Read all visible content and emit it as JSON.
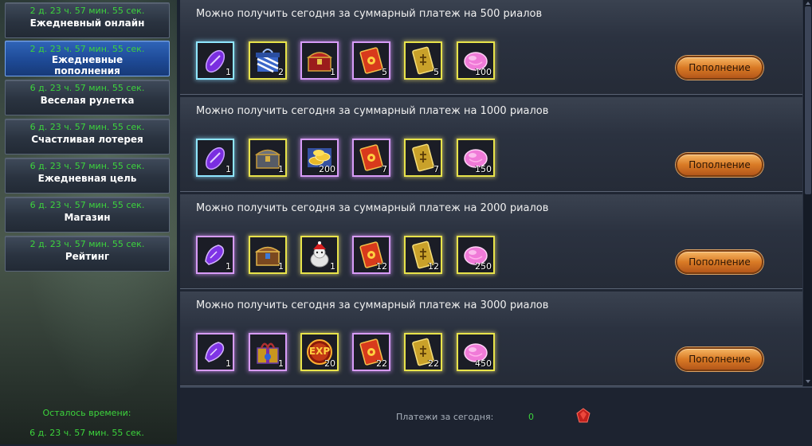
{
  "sidebar": {
    "items": [
      {
        "timer": "2 д. 23 ч. 57 мин. 55 сек.",
        "label": "Ежедневный онлайн"
      },
      {
        "timer": "2 д. 23 ч. 57 мин. 55 сек.",
        "label": "Ежедневные пополнения"
      },
      {
        "timer": "6 д. 23 ч. 57 мин. 55 сек.",
        "label": "Веселая рулетка"
      },
      {
        "timer": "6 д. 23 ч. 57 мин. 55 сек.",
        "label": "Счастливая лотерея"
      },
      {
        "timer": "6 д. 23 ч. 57 мин. 55 сек.",
        "label": "Ежедневная цель"
      },
      {
        "timer": "6 д. 23 ч. 57 мин. 55 сек.",
        "label": "Магазин"
      },
      {
        "timer": "2 д. 23 ч. 57 мин. 55 сек.",
        "label": "Рейтинг"
      }
    ],
    "active_index": 1,
    "remaining_label": "Осталось времени:",
    "remaining_value": "6 д. 23 ч. 57 мин. 55 сек."
  },
  "rewards": [
    {
      "title": "Можно получить сегодня за суммарный платеж на 500 риалов",
      "button": "Пополнение",
      "items": [
        {
          "icon": "purple-crystal-icon",
          "frame": "cyan",
          "count": "1"
        },
        {
          "icon": "blue-striped-gift-box-icon",
          "frame": "yellow",
          "count": "2"
        },
        {
          "icon": "red-treasure-chest-icon",
          "frame": "purple",
          "count": "1"
        },
        {
          "icon": "red-talisman-card-icon",
          "frame": "purple",
          "count": "5"
        },
        {
          "icon": "gold-ticket-icon",
          "frame": "yellow",
          "count": "5"
        },
        {
          "icon": "pink-jade-stone-icon",
          "frame": "yellow",
          "count": "100"
        }
      ]
    },
    {
      "title": "Можно получить сегодня за суммарный платеж на 1000 риалов",
      "button": "Пополнение",
      "items": [
        {
          "icon": "purple-crystal-icon",
          "frame": "cyan",
          "count": "1"
        },
        {
          "icon": "iron-treasure-chest-icon",
          "frame": "yellow",
          "count": "1"
        },
        {
          "icon": "gold-coin-pile-icon",
          "frame": "purple",
          "count": "200"
        },
        {
          "icon": "red-talisman-card-icon",
          "frame": "purple",
          "count": "7"
        },
        {
          "icon": "gold-ticket-icon",
          "frame": "yellow",
          "count": "7"
        },
        {
          "icon": "pink-jade-stone-icon",
          "frame": "yellow",
          "count": "150"
        }
      ]
    },
    {
      "title": "Можно получить сегодня за суммарный платеж на 2000 риалов",
      "button": "Пополнение",
      "items": [
        {
          "icon": "purple-shoe-icon",
          "frame": "purple",
          "count": "1"
        },
        {
          "icon": "wooden-treasure-chest-icon",
          "frame": "yellow",
          "count": "1"
        },
        {
          "icon": "santa-pet-icon",
          "frame": "yellow",
          "count": "1"
        },
        {
          "icon": "red-talisman-card-icon",
          "frame": "purple",
          "count": "12"
        },
        {
          "icon": "gold-ticket-icon",
          "frame": "yellow",
          "count": "12"
        },
        {
          "icon": "pink-jade-stone-icon",
          "frame": "yellow",
          "count": "250"
        }
      ]
    },
    {
      "title": "Можно получить сегодня за суммарный платеж на 3000 риалов",
      "button": "Пополнение",
      "items": [
        {
          "icon": "purple-shoe-icon",
          "frame": "purple",
          "count": "1"
        },
        {
          "icon": "gold-gift-box-icon",
          "frame": "purple",
          "count": "1"
        },
        {
          "icon": "exp-orb-icon",
          "frame": "yellow",
          "count": "20"
        },
        {
          "icon": "red-talisman-card-icon",
          "frame": "purple",
          "count": "22"
        },
        {
          "icon": "gold-ticket-icon",
          "frame": "yellow",
          "count": "22"
        },
        {
          "icon": "pink-jade-stone-icon",
          "frame": "yellow",
          "count": "450"
        }
      ]
    }
  ],
  "footer": {
    "label": "Платежи за сегодня:",
    "value": "0",
    "currency_icon": "red-gem-icon"
  },
  "icon_labels": {
    "exp": "EXP"
  },
  "colors": {
    "timer_green": "#3cd43c",
    "active_tab": "#1e4a96",
    "button_orange": "#d97a25"
  }
}
